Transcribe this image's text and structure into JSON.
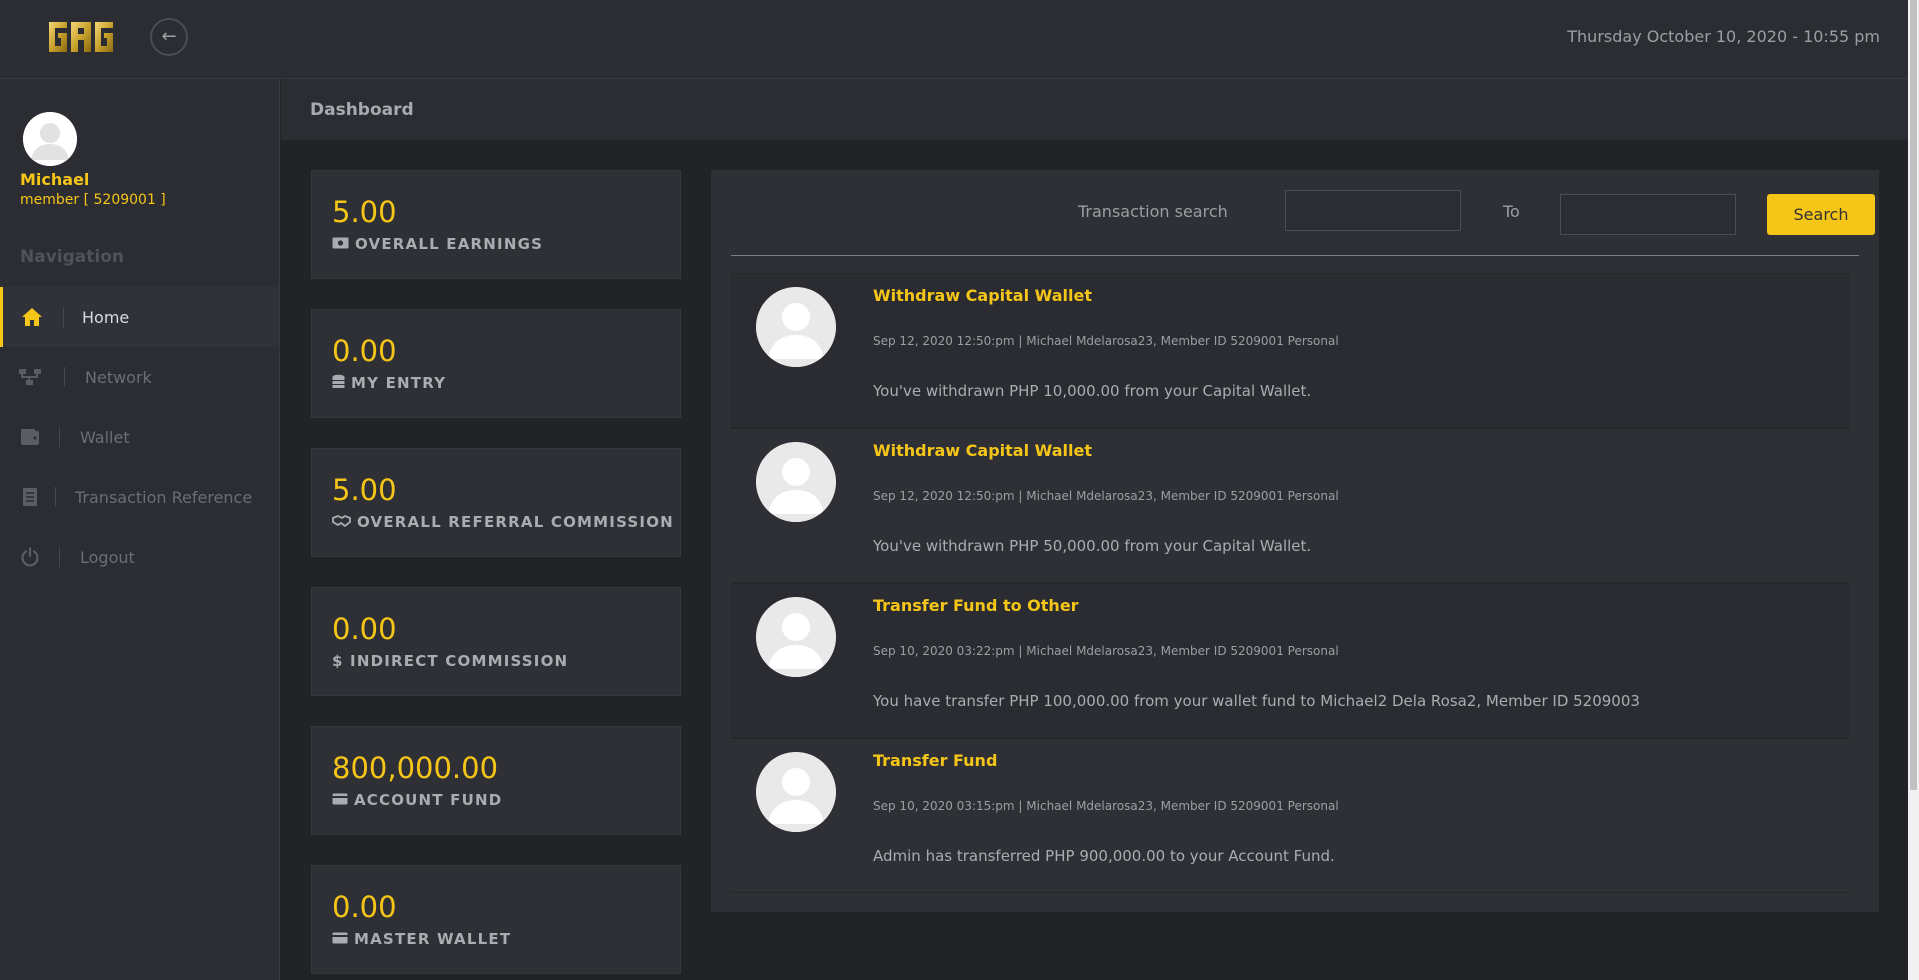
{
  "header": {
    "datetime": "Thursday October 10, 2020 - 10:55 pm",
    "back_icon": "arrow-left-icon",
    "logo_text": "GAG"
  },
  "user": {
    "name": "Michael",
    "member": "member [ 5209001 ]"
  },
  "sidebar": {
    "heading": "Navigation",
    "items": [
      {
        "label": "Home",
        "icon": "home-icon",
        "active": true
      },
      {
        "label": "Network",
        "icon": "network-icon",
        "active": false
      },
      {
        "label": "Wallet",
        "icon": "wallet-icon",
        "active": false
      },
      {
        "label": "Transaction Reference",
        "icon": "document-icon",
        "active": false
      },
      {
        "label": "Logout",
        "icon": "power-icon",
        "active": false
      }
    ]
  },
  "page": {
    "title": "Dashboard"
  },
  "stats": [
    {
      "value": "5.00",
      "label": "OVERALL EARNINGS",
      "icon": "money-icon"
    },
    {
      "value": "0.00",
      "label": "MY ENTRY",
      "icon": "coins-icon"
    },
    {
      "value": "5.00",
      "label": "OVERALL REFERRAL COMMISSION",
      "icon": "handshake-icon"
    },
    {
      "value": "0.00",
      "label": "$ INDIRECT COMMISSION",
      "icon": ""
    },
    {
      "value": "800,000.00",
      "label": "ACCOUNT FUND",
      "icon": "card-icon"
    },
    {
      "value": "0.00",
      "label": "MASTER WALLET",
      "icon": "card-icon"
    }
  ],
  "search": {
    "label": "Transaction search",
    "to_label": "To",
    "from_value": "",
    "to_value": "",
    "button_label": "Search"
  },
  "transactions": [
    {
      "title": "Withdraw Capital Wallet",
      "meta": "Sep 12, 2020 12:50:pm | Michael Mdelarosa23, Member ID 5209001 Personal",
      "body": "You've withdrawn PHP 10,000.00 from your Capital Wallet."
    },
    {
      "title": "Withdraw Capital Wallet",
      "meta": "Sep 12, 2020 12:50:pm | Michael Mdelarosa23, Member ID 5209001 Personal",
      "body": "You've withdrawn PHP 50,000.00 from your Capital Wallet."
    },
    {
      "title": "Transfer Fund to Other",
      "meta": "Sep 10, 2020 03:22:pm | Michael Mdelarosa23, Member ID 5209001 Personal",
      "body": "You have transfer PHP 100,000.00 from your wallet fund to Michael2 Dela Rosa2, Member ID 5209003"
    },
    {
      "title": "Transfer Fund",
      "meta": "Sep 10, 2020 03:15:pm | Michael Mdelarosa23, Member ID 5209001 Personal",
      "body": "Admin has transferred PHP 900,000.00 to your Account Fund."
    }
  ],
  "colors": {
    "accent": "#f5c518",
    "background": "#212327",
    "panel": "#2e3035"
  }
}
